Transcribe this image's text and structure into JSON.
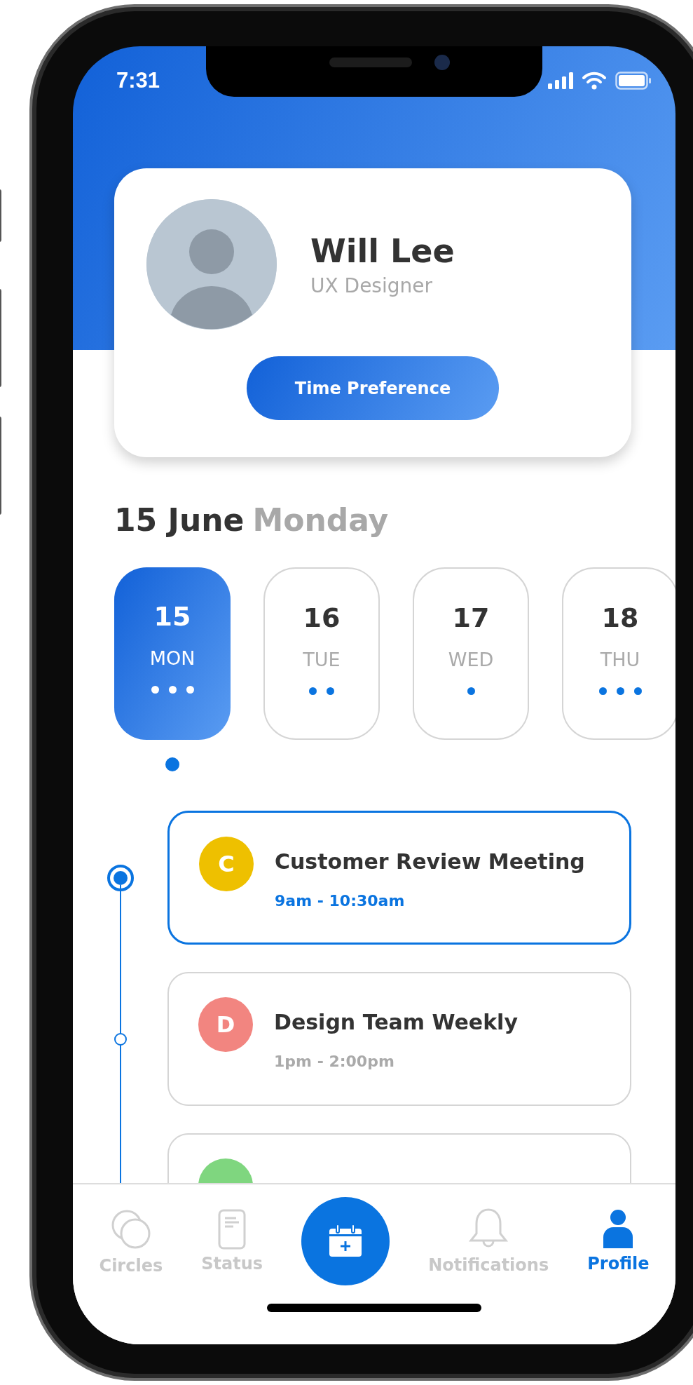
{
  "status_bar": {
    "time": "7:31"
  },
  "profile": {
    "name": "Will Lee",
    "role": "UX Designer",
    "button": "Time Preference"
  },
  "date_heading": {
    "date": "15 June",
    "weekday": "Monday"
  },
  "days": [
    {
      "day": "15",
      "weekday": "MON",
      "selected": true,
      "dots": [
        {
          "kind": "event"
        },
        {
          "kind": "event"
        },
        {
          "kind": "event"
        }
      ]
    },
    {
      "day": "16",
      "weekday": "TUE",
      "selected": false,
      "dots": [
        {
          "kind": "event"
        },
        {
          "kind": "event"
        }
      ]
    },
    {
      "day": "17",
      "weekday": "WED",
      "selected": false,
      "dots": [
        {
          "kind": "event"
        }
      ]
    },
    {
      "day": "18",
      "weekday": "THU",
      "selected": false,
      "dots": [
        {
          "kind": "event"
        },
        {
          "kind": "event"
        },
        {
          "kind": "event"
        }
      ]
    }
  ],
  "events": [
    {
      "initial": "C",
      "title": "Customer Review Meeting",
      "time": "9am - 10:30am",
      "color": "#eec000",
      "selected": true
    },
    {
      "initial": "D",
      "title": "Design Team Weekly",
      "time": "1pm - 2:00pm",
      "color": "#f28580",
      "selected": false
    },
    {
      "color": "#7fd67f",
      "selected": false
    }
  ],
  "nav": [
    {
      "kind": "circles",
      "label": "Circles",
      "selected": false
    },
    {
      "kind": "status",
      "label": "Status",
      "selected": false
    },
    {
      "kind": "add"
    },
    {
      "kind": "notifications",
      "label": "Notifications",
      "selected": false
    },
    {
      "kind": "profile",
      "label": "Profile",
      "selected": true
    }
  ]
}
